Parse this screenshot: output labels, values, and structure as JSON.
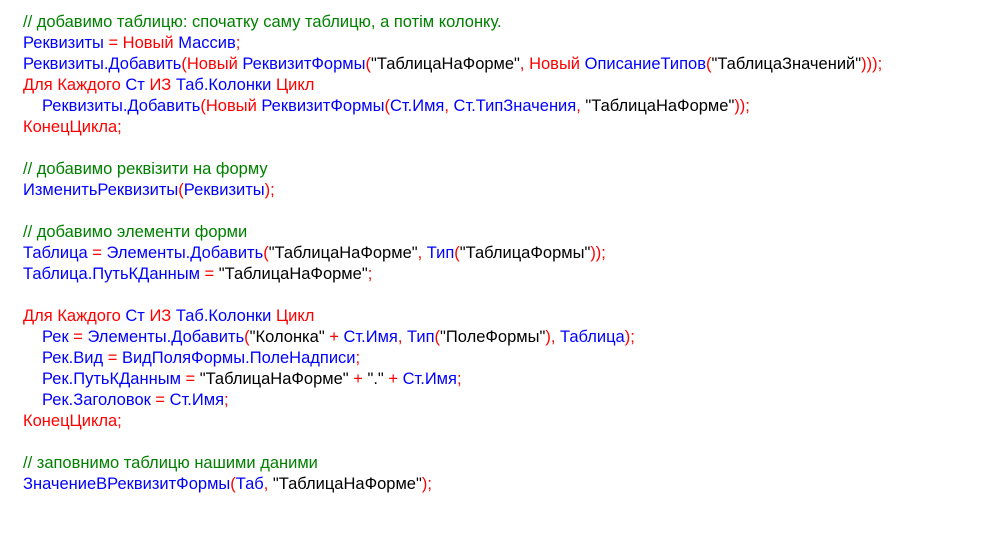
{
  "colors": {
    "identifier": "#0000ff",
    "keyword_operator": "#ff0000",
    "comment": "#008000",
    "string": "#000000",
    "background": "#ffffff"
  },
  "code": {
    "lines": [
      {
        "indent": false,
        "tokens": [
          {
            "t": "cm",
            "v": "// добавимо таблицю: спочатку саму таблицю, а потім колонку."
          }
        ]
      },
      {
        "indent": false,
        "tokens": [
          {
            "t": "id",
            "v": "Реквизиты "
          },
          {
            "t": "kw",
            "v": "= Новый "
          },
          {
            "t": "id",
            "v": "Массив"
          },
          {
            "t": "kw",
            "v": ";"
          }
        ]
      },
      {
        "indent": false,
        "tokens": [
          {
            "t": "id",
            "v": "Реквизиты.Добавить"
          },
          {
            "t": "kw",
            "v": "(Новый "
          },
          {
            "t": "id",
            "v": "РеквизитФормы"
          },
          {
            "t": "kw",
            "v": "("
          },
          {
            "t": "st",
            "v": "\"ТаблицаНаФорме\""
          },
          {
            "t": "kw",
            "v": ", Новый "
          },
          {
            "t": "id",
            "v": "ОписаниеТипов"
          },
          {
            "t": "kw",
            "v": "("
          },
          {
            "t": "st",
            "v": "\"ТаблицаЗначений\""
          },
          {
            "t": "kw",
            "v": ")));"
          }
        ]
      },
      {
        "indent": false,
        "tokens": [
          {
            "t": "kw",
            "v": "Для Каждого "
          },
          {
            "t": "id",
            "v": "Ст "
          },
          {
            "t": "kw",
            "v": "ИЗ "
          },
          {
            "t": "id",
            "v": "Таб.Колонки "
          },
          {
            "t": "kw",
            "v": "Цикл"
          }
        ]
      },
      {
        "indent": true,
        "tokens": [
          {
            "t": "id",
            "v": "Реквизиты.Добавить"
          },
          {
            "t": "kw",
            "v": "(Новый "
          },
          {
            "t": "id",
            "v": "РеквизитФормы"
          },
          {
            "t": "kw",
            "v": "("
          },
          {
            "t": "id",
            "v": "Ст.Имя"
          },
          {
            "t": "kw",
            "v": ", "
          },
          {
            "t": "id",
            "v": "Ст.ТипЗначения"
          },
          {
            "t": "kw",
            "v": ", "
          },
          {
            "t": "st",
            "v": "\"ТаблицаНаФорме\""
          },
          {
            "t": "kw",
            "v": "));"
          }
        ]
      },
      {
        "indent": false,
        "tokens": [
          {
            "t": "kw",
            "v": "КонецЦикла;"
          }
        ]
      },
      {
        "indent": false,
        "tokens": []
      },
      {
        "indent": false,
        "tokens": [
          {
            "t": "cm",
            "v": "// добавимо реквізити на форму"
          }
        ]
      },
      {
        "indent": false,
        "tokens": [
          {
            "t": "id",
            "v": "ИзменитьРеквизиты"
          },
          {
            "t": "kw",
            "v": "("
          },
          {
            "t": "id",
            "v": "Реквизиты"
          },
          {
            "t": "kw",
            "v": ");"
          }
        ]
      },
      {
        "indent": false,
        "tokens": []
      },
      {
        "indent": false,
        "tokens": [
          {
            "t": "cm",
            "v": "// добавимо элементи форми"
          }
        ]
      },
      {
        "indent": false,
        "tokens": [
          {
            "t": "id",
            "v": "Таблица "
          },
          {
            "t": "kw",
            "v": "= "
          },
          {
            "t": "id",
            "v": "Элементы.Добавить"
          },
          {
            "t": "kw",
            "v": "("
          },
          {
            "t": "st",
            "v": "\"ТаблицаНаФорме\""
          },
          {
            "t": "kw",
            "v": ", "
          },
          {
            "t": "id",
            "v": "Тип"
          },
          {
            "t": "kw",
            "v": "("
          },
          {
            "t": "st",
            "v": "\"ТаблицаФормы\""
          },
          {
            "t": "kw",
            "v": "));"
          }
        ]
      },
      {
        "indent": false,
        "tokens": [
          {
            "t": "id",
            "v": "Таблица.ПутьКДанным "
          },
          {
            "t": "kw",
            "v": "= "
          },
          {
            "t": "st",
            "v": "\"ТаблицаНаФорме\""
          },
          {
            "t": "kw",
            "v": ";"
          }
        ]
      },
      {
        "indent": false,
        "tokens": []
      },
      {
        "indent": false,
        "tokens": [
          {
            "t": "kw",
            "v": "Для Каждого "
          },
          {
            "t": "id",
            "v": "Ст "
          },
          {
            "t": "kw",
            "v": "ИЗ "
          },
          {
            "t": "id",
            "v": "Таб.Колонки "
          },
          {
            "t": "kw",
            "v": "Цикл"
          }
        ]
      },
      {
        "indent": true,
        "tokens": [
          {
            "t": "id",
            "v": "Рек "
          },
          {
            "t": "kw",
            "v": "= "
          },
          {
            "t": "id",
            "v": "Элементы.Добавить"
          },
          {
            "t": "kw",
            "v": "("
          },
          {
            "t": "st",
            "v": "\"Колонка\""
          },
          {
            "t": "kw",
            "v": " + "
          },
          {
            "t": "id",
            "v": "Ст.Имя"
          },
          {
            "t": "kw",
            "v": ", "
          },
          {
            "t": "id",
            "v": "Тип"
          },
          {
            "t": "kw",
            "v": "("
          },
          {
            "t": "st",
            "v": "\"ПолеФормы\""
          },
          {
            "t": "kw",
            "v": "), "
          },
          {
            "t": "id",
            "v": "Таблица"
          },
          {
            "t": "kw",
            "v": ");"
          }
        ]
      },
      {
        "indent": true,
        "tokens": [
          {
            "t": "id",
            "v": "Рек.Вид "
          },
          {
            "t": "kw",
            "v": "= "
          },
          {
            "t": "id",
            "v": "ВидПоляФормы.ПолеНадписи"
          },
          {
            "t": "kw",
            "v": ";"
          }
        ]
      },
      {
        "indent": true,
        "tokens": [
          {
            "t": "id",
            "v": "Рек.ПутьКДанным "
          },
          {
            "t": "kw",
            "v": "= "
          },
          {
            "t": "st",
            "v": "\"ТаблицаНаФорме\""
          },
          {
            "t": "kw",
            "v": " + "
          },
          {
            "t": "st",
            "v": "\".\""
          },
          {
            "t": "kw",
            "v": " + "
          },
          {
            "t": "id",
            "v": "Ст.Имя"
          },
          {
            "t": "kw",
            "v": ";"
          }
        ]
      },
      {
        "indent": true,
        "tokens": [
          {
            "t": "id",
            "v": "Рек.Заголовок "
          },
          {
            "t": "kw",
            "v": "= "
          },
          {
            "t": "id",
            "v": "Ст.Имя"
          },
          {
            "t": "kw",
            "v": ";"
          }
        ]
      },
      {
        "indent": false,
        "tokens": [
          {
            "t": "kw",
            "v": "КонецЦикла;"
          }
        ]
      },
      {
        "indent": false,
        "tokens": []
      },
      {
        "indent": false,
        "tokens": [
          {
            "t": "cm",
            "v": "// заповнимо таблицю нашими даними"
          }
        ]
      },
      {
        "indent": false,
        "tokens": [
          {
            "t": "id",
            "v": "ЗначениеВРеквизитФормы"
          },
          {
            "t": "kw",
            "v": "("
          },
          {
            "t": "id",
            "v": "Таб"
          },
          {
            "t": "kw",
            "v": ", "
          },
          {
            "t": "st",
            "v": "\"ТаблицаНаФорме\""
          },
          {
            "t": "kw",
            "v": ");"
          }
        ]
      }
    ]
  }
}
